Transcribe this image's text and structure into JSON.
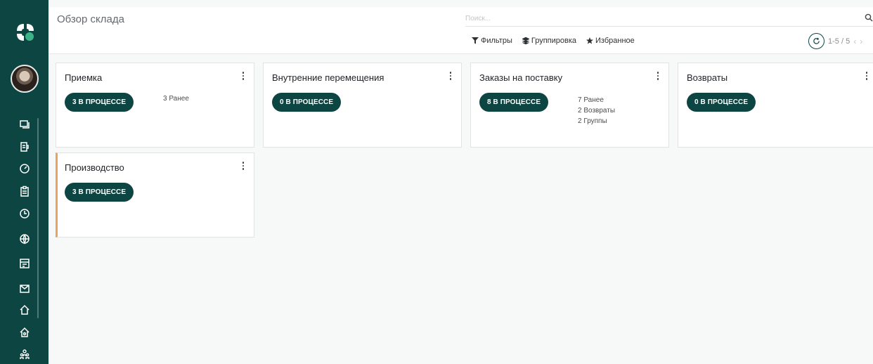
{
  "header": {
    "title": "Обзор склада",
    "search_placeholder": "Поиск...",
    "filters_label": "Фильтры",
    "groupby_label": "Группировка",
    "favorites_label": "Избранное",
    "pager_text": "1-5 / 5",
    "prev_arrow": "‹",
    "next_arrow": "›"
  },
  "sidebar": {
    "icons": [
      "chat-icon",
      "invoice-icon",
      "dashboard-icon",
      "clipboard-icon",
      "clock-icon",
      "globe-icon",
      "calendar-card-icon",
      "mail-icon",
      "home-icon",
      "house-icon",
      "people-icon"
    ]
  },
  "cards": [
    {
      "title": "Приемка",
      "progress": "3 В ПРОЦЕССЕ",
      "links": [
        "3 Ранее"
      ]
    },
    {
      "title": "Внутренние перемещения",
      "progress": "0 В ПРОЦЕССЕ",
      "links": []
    },
    {
      "title": "Заказы на поставку",
      "progress": "8 В ПРОЦЕССЕ",
      "links": [
        "7 Ранее",
        "2 Возвраты",
        "2 Группы"
      ]
    },
    {
      "title": "Возвраты",
      "progress": "0 В ПРОЦЕССЕ",
      "links": []
    },
    {
      "title": "Производство",
      "progress": "3 В ПРОЦЕССЕ",
      "links": []
    }
  ],
  "colors": {
    "brand": "#0d4543",
    "accent_border": "#e9a35b",
    "background": "#f7f8f8"
  }
}
